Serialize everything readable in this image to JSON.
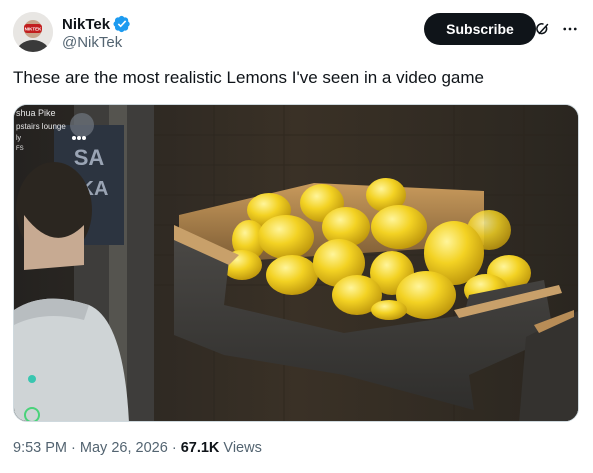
{
  "author": {
    "display_name": "NikTek",
    "handle": "@NikTek",
    "avatar_badge": "NIKTEK"
  },
  "actions": {
    "subscribe_label": "Subscribe",
    "grok_icon": "grok-icon",
    "more_icon": "more-icon"
  },
  "tweet": {
    "text": "These are the most realistic Lemons I've seen in a video game"
  },
  "media": {
    "hud": {
      "player_name": "shua Pike",
      "location": "pstairs lounge",
      "line3": "ly",
      "line4": "FS",
      "sign_top": "SA",
      "sign_bottom": "KA"
    }
  },
  "meta": {
    "time": "9:53 PM",
    "separator1": "·",
    "date": "May 26, 2026",
    "separator2": "·",
    "views_count": "67.1K",
    "views_label": "Views"
  },
  "colors": {
    "verified_blue": "#1d9bf0",
    "subscribe_bg": "#0f1419",
    "secondary_text": "#536471"
  }
}
